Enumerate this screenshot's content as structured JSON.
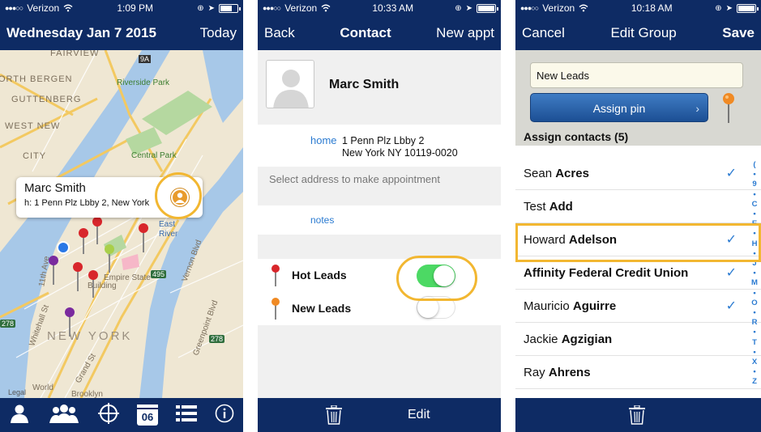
{
  "screen1": {
    "carrier": "Verizon",
    "time": "1:09 PM",
    "title": "Wednesday Jan 7 2015",
    "today_label": "Today",
    "map_labels": {
      "fairview": "FAIRVIEW",
      "north_bergen": "ORTH BERGEN",
      "guttenberg": "GUTTENBERG",
      "west_new": "WEST NEW",
      "city": "CITY",
      "riverside": "Riverside Park",
      "central": "Central Park",
      "new_york": "NEW YORK",
      "east_river": "East",
      "east_river2": "River",
      "empire": "Empire State",
      "empire2": "Building",
      "vernon": "Vernon Blvd",
      "greenpoint": "Greenpoint Blvd",
      "grand": "Grand St",
      "whitehall": "Whitehall St",
      "route9a": "9A",
      "route495": "495",
      "route278": "278",
      "route278b": "278",
      "brooklyn": "Brooklyn",
      "world": "World",
      "street11": "11th Ave"
    },
    "callout": {
      "name": "Marc Smith",
      "address": "h: 1 Penn Plz Lbby 2, New York"
    },
    "legal": "Legal",
    "tabs": [
      "contact-tab",
      "groups-tab",
      "locate-tab",
      "calendar-tab",
      "list-tab",
      "info-tab"
    ],
    "calendar_day": "06"
  },
  "screen2": {
    "carrier": "Verizon",
    "time": "10:33 AM",
    "back_label": "Back",
    "title": "Contact",
    "new_appt_label": "New appt",
    "contact_name": "Marc Smith",
    "address_label": "home",
    "address_line1": "1 Penn Plz Lbby 2",
    "address_line2": "New York NY 10119-0020",
    "select_hint": "Select address to make appointment",
    "notes_label": "notes",
    "groups": [
      {
        "name": "Hot Leads",
        "on": true,
        "pin_color": "#d8262b"
      },
      {
        "name": "New Leads",
        "on": false,
        "pin_color": "#f08a24"
      }
    ],
    "edit_label": "Edit"
  },
  "screen3": {
    "carrier": "Verizon",
    "time": "10:18 AM",
    "cancel_label": "Cancel",
    "title": "Edit Group",
    "save_label": "Save",
    "group_name": "New Leads",
    "assign_pin_label": "Assign pin",
    "assign_contacts_label": "Assign contacts (5)",
    "contacts": [
      {
        "first": "Sean",
        "last": "Acres",
        "checked": true
      },
      {
        "first": "Test",
        "last": "Add",
        "checked": false
      },
      {
        "first": "Howard",
        "last": "Adelson",
        "checked": true
      },
      {
        "first": "",
        "last": "Affinity Federal Credit Union",
        "checked": true
      },
      {
        "first": "Mauricio",
        "last": "Aguirre",
        "checked": true
      },
      {
        "first": "Jackie",
        "last": "Agzigian",
        "checked": false
      },
      {
        "first": "Ray",
        "last": "Ahrens",
        "checked": false
      }
    ],
    "index_letters": [
      "(",
      "9",
      "C",
      "E",
      "H",
      "J",
      "M",
      "O",
      "R",
      "T",
      "X",
      "Z"
    ]
  },
  "colors": {
    "navbar": "#0e2b64",
    "accent_blue": "#2b7bd1",
    "highlight": "#f2b731",
    "toggle_on": "#4cd964"
  }
}
